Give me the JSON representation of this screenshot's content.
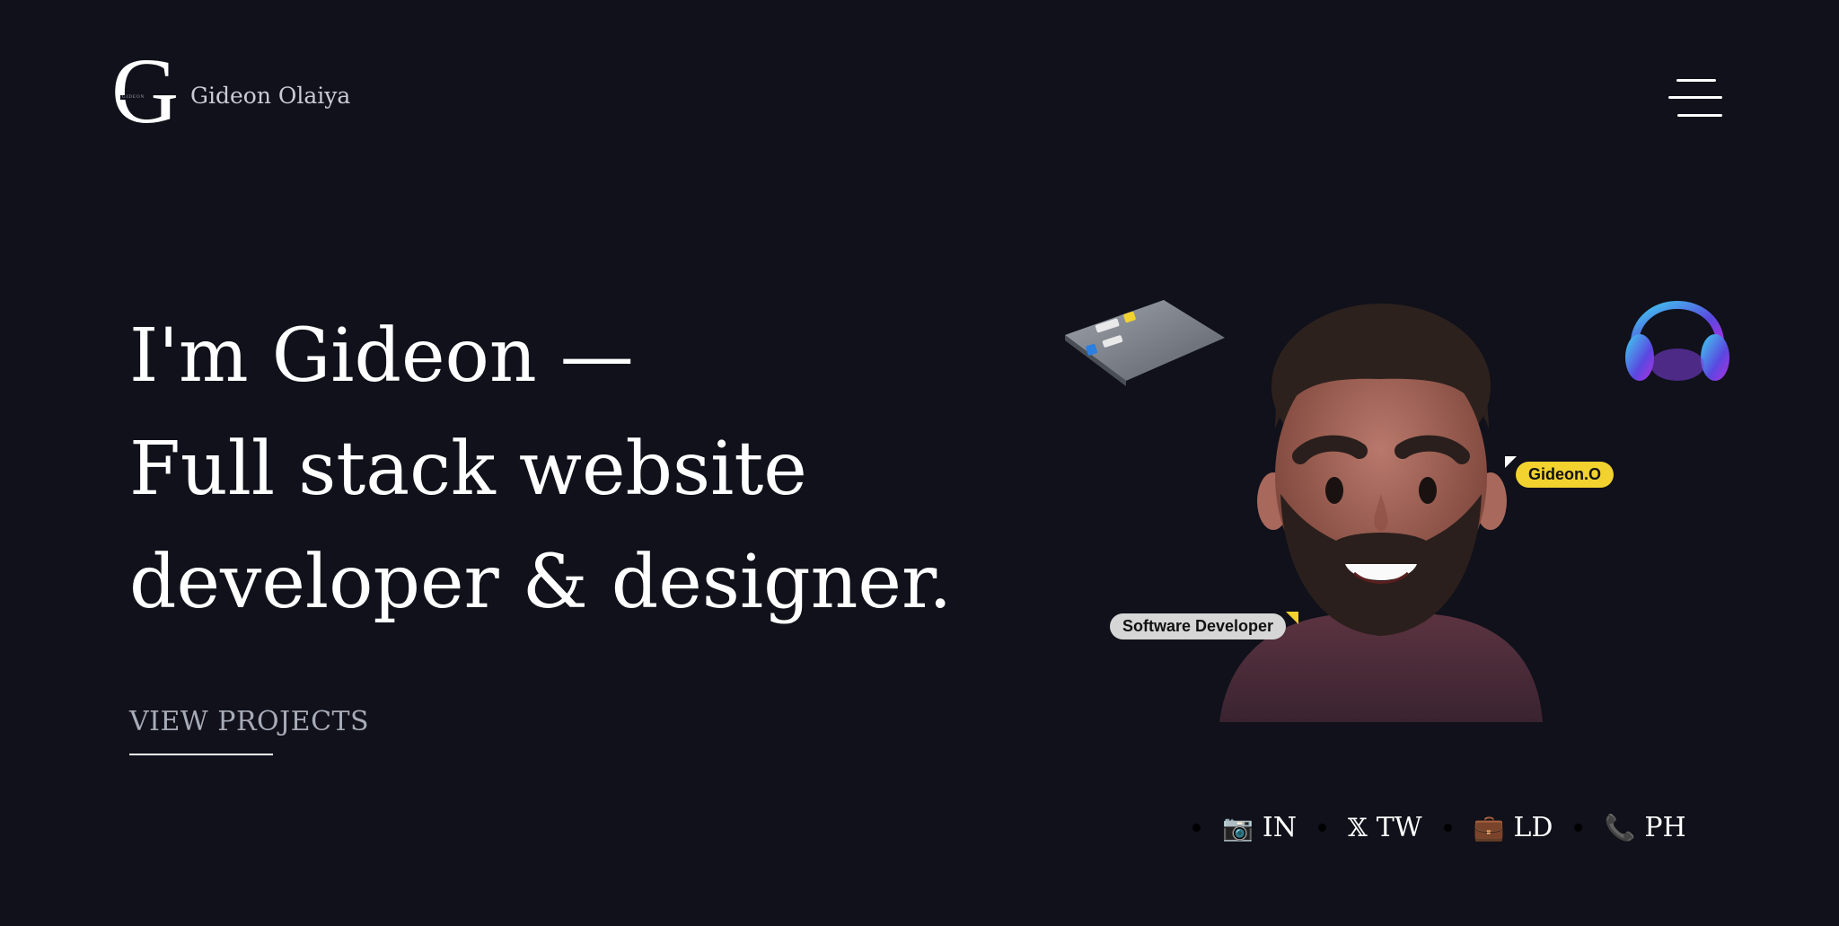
{
  "header": {
    "logo_letter": "G",
    "logo_small_text": "GIDEON",
    "brand_name": "Gideon Olaiya"
  },
  "hero": {
    "title_lines": [
      "I'm Gideon —",
      "Full stack website",
      "developer & designer."
    ],
    "cta_label": "VIEW PROJECTS"
  },
  "illustration": {
    "name_badge": "Gideon.O",
    "role_badge": "Software Developer"
  },
  "social": [
    {
      "icon": "camera-icon",
      "glyph": "📷",
      "label": "IN"
    },
    {
      "icon": "x-logo-icon",
      "glyph": "𝕏",
      "label": "TW"
    },
    {
      "icon": "briefcase-icon",
      "glyph": "💼",
      "label": "LD"
    },
    {
      "icon": "phone-icon",
      "glyph": "📞",
      "label": "PH"
    }
  ],
  "colors": {
    "background": "#10111a",
    "text": "#ffffff",
    "muted": "#a7abb8",
    "badge_yellow": "#f1d22f"
  }
}
